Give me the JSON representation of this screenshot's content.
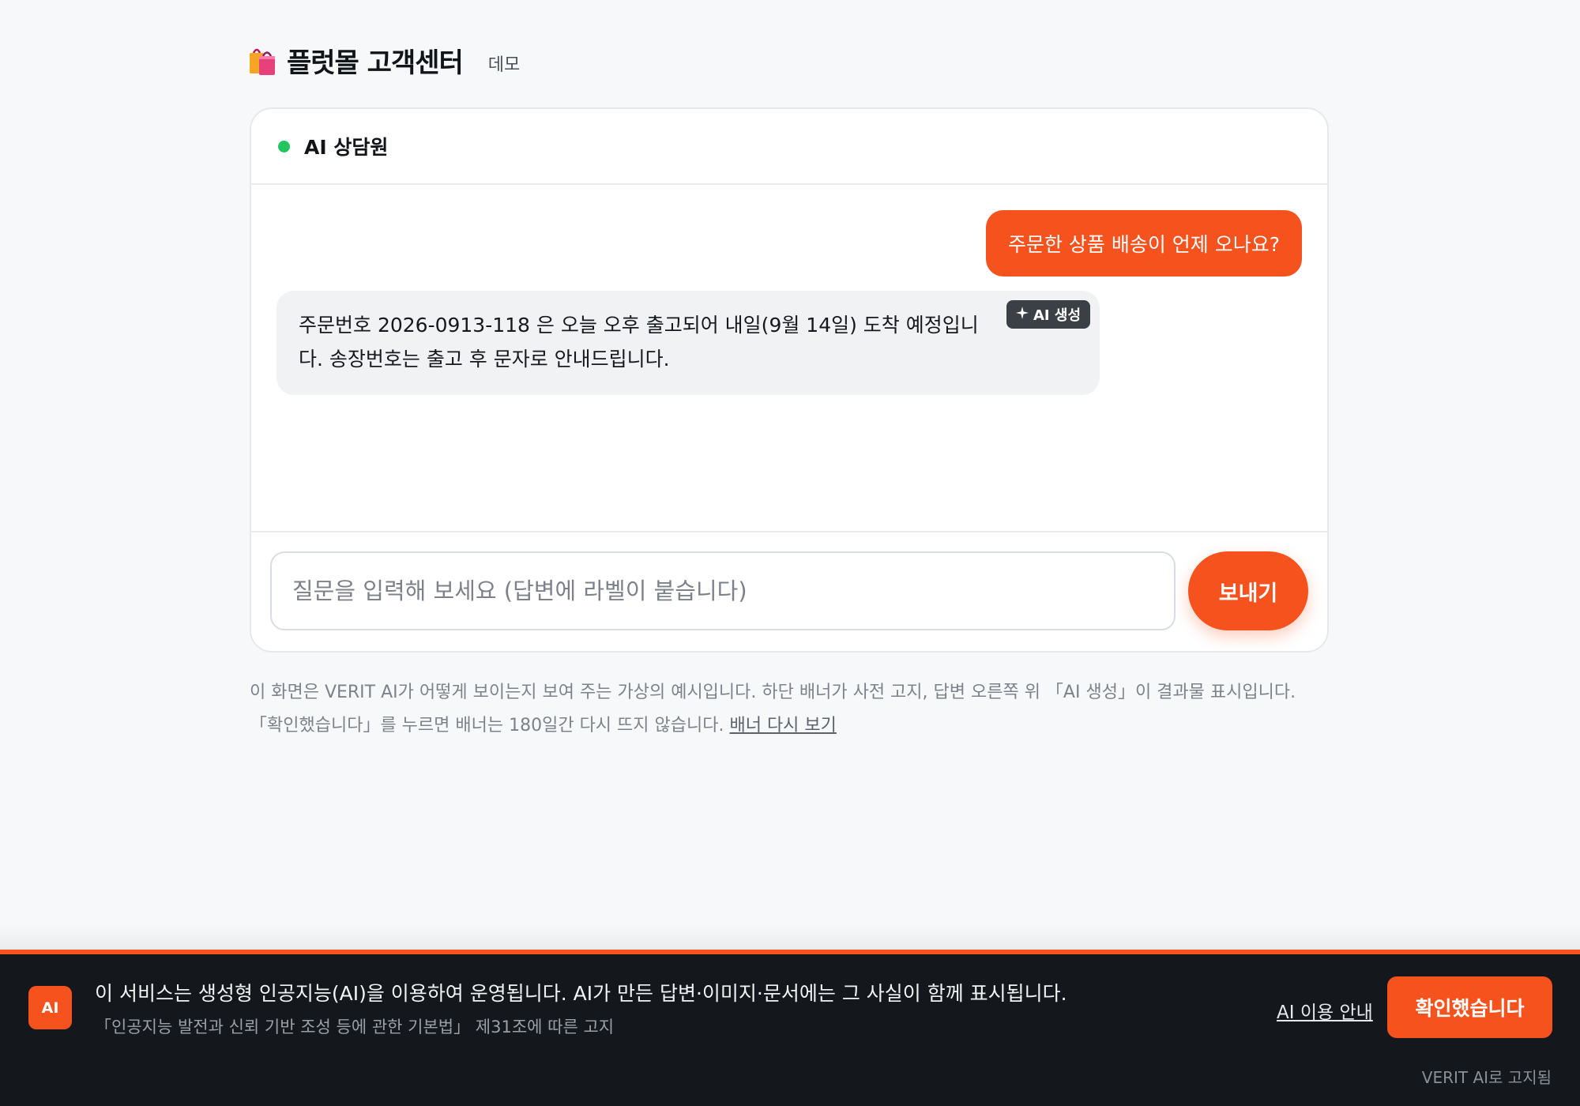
{
  "header": {
    "title": "플럿몰 고객센터",
    "tag": "데모",
    "brand_icon": "shopping-bags-icon"
  },
  "chat": {
    "agent_name": "AI 상담원",
    "status_color": "#22c55e",
    "messages": [
      {
        "role": "user",
        "text": "주문한 상품 배송이 언제 오나요?"
      },
      {
        "role": "ai",
        "text": "주문번호 2026-0913-118 은 오늘 오후 출고되어 내일(9월 14일) 도착 예정입니다. 송장번호는 출고 후 문자로 안내드립니다.",
        "badge": "AI 생성",
        "badge_icon": "sparkle-icon"
      }
    ],
    "input_placeholder": "질문을 입력해 보세요 (답변에 라벨이 붙습니다)",
    "send_label": "보내기"
  },
  "footnote": {
    "text": "이 화면은 VERIT AI가 어떻게 보이는지 보여 주는 가상의 예시입니다. 하단 배너가 사전 고지, 답변 오른쪽 위 「AI 생성」이 결과물 표시입니다. 「확인했습니다」를 누르면 배너는 180일간 다시 뜨지 않습니다.",
    "link": "배너 다시 보기"
  },
  "banner": {
    "icon_label": "AI",
    "main_text": "이 서비스는 생성형 인공지능(AI)을 이용하여 운영됩니다. AI가 만든 답변·이미지·문서에는 그 사실이 함께 표시됩니다.",
    "sub_text": "「인공지능 발전과 신뢰 기반 조성 등에 관한 기본법」 제31조에 따른 고지",
    "guide_link": "AI 이용 안내",
    "confirm_label": "확인했습니다",
    "credit": "VERIT AI로 고지됨"
  },
  "colors": {
    "accent": "#f5521e",
    "banner_bg": "#14171c",
    "page_bg": "#f7f8fa"
  }
}
